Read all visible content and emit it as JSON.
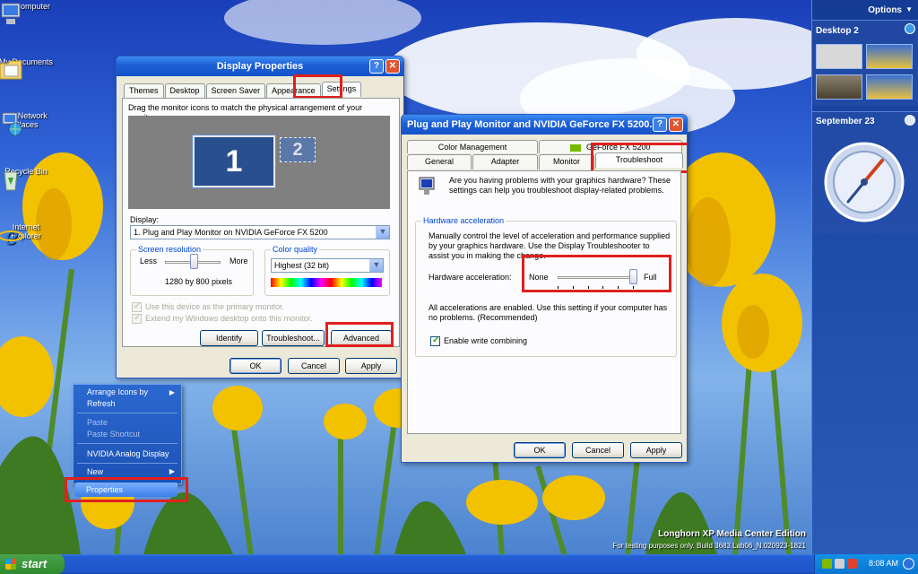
{
  "desktop": {
    "icons": [
      {
        "label": "My Computer"
      },
      {
        "label": "My Documents"
      },
      {
        "label": "My Network Places"
      },
      {
        "label": "Recycle Bin"
      },
      {
        "label": "Internet Explorer"
      }
    ],
    "watermark": {
      "edition": "Longhorn XP Media Center Edition",
      "build": "For testing purposes only. Build 3683.Lab06_N.020923-1821"
    }
  },
  "display_properties": {
    "title": "Display Properties",
    "tabs": [
      "Themes",
      "Desktop",
      "Screen Saver",
      "Appearance",
      "Settings"
    ],
    "instruction": "Drag the monitor icons to match the physical arrangement of your monitors.",
    "monitor_1": "1",
    "monitor_2": "2",
    "display_label": "Display:",
    "display_value": "1. Plug and Play Monitor on NVIDIA GeForce FX 5200",
    "screen_resolution_title": "Screen resolution",
    "less": "Less",
    "more": "More",
    "resolution_value": "1280 by 800 pixels",
    "color_quality_title": "Color quality",
    "color_value": "Highest (32 bit)",
    "primary_monitor": "Use this device as the primary monitor.",
    "extend_desktop": "Extend my Windows desktop onto this monitor.",
    "identify": "Identify",
    "troubleshoot": "Troubleshoot...",
    "advanced": "Advanced",
    "ok": "OK",
    "cancel": "Cancel",
    "apply": "Apply"
  },
  "pnp_dialog": {
    "title": "Plug and Play Monitor and NVIDIA GeForce FX 5200...",
    "tabs_top": [
      "Color Management",
      "GeForce FX 5200"
    ],
    "tabs_bottom": [
      "General",
      "Adapter",
      "Monitor",
      "Troubleshoot"
    ],
    "intro": "Are you having problems with your graphics hardware? These settings can help you troubleshoot display-related problems.",
    "hw_group_title": "Hardware acceleration",
    "hw_desc": "Manually control the level of acceleration and performance supplied by your graphics hardware. Use the Display Troubleshooter to assist you in making the change.",
    "hw_label": "Hardware acceleration:",
    "none": "None",
    "full": "Full",
    "acceleration_level": 1.0,
    "status": "All accelerations are enabled. Use this setting if your computer has no problems. (Recommended)",
    "write_combining": "Enable write combining",
    "ok": "OK",
    "cancel": "Cancel",
    "apply": "Apply"
  },
  "context_menu": {
    "items": [
      "Arrange Icons by",
      "Refresh",
      "Paste",
      "Paste Shortcut",
      "NVIDIA Analog Display",
      "New",
      "Properties"
    ]
  },
  "sidebar": {
    "options": "Options",
    "desktop": "Desktop 2",
    "date": "September 23"
  },
  "taskbar": {
    "start": "start",
    "clock": "8:08 AM"
  },
  "colors": {
    "accent_red": "#e0201e",
    "xp_blue": "#1d5fd6"
  }
}
